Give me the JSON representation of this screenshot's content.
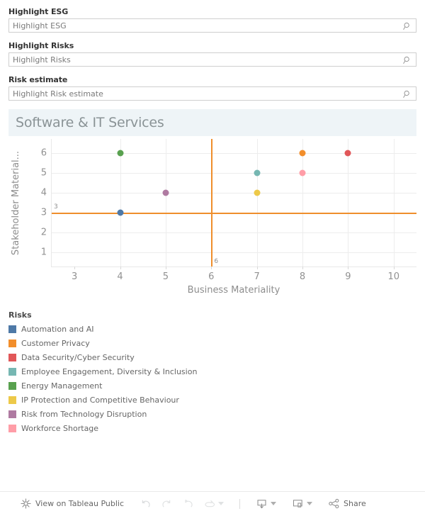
{
  "filters": [
    {
      "label": "Highlight ESG",
      "placeholder": "Highlight ESG",
      "value": "",
      "icon": "search-icon"
    },
    {
      "label": "Highlight Risks",
      "placeholder": "Highlight Risks",
      "value": "",
      "icon": "search-icon"
    },
    {
      "label": "Risk estimate",
      "placeholder": "Highlight Risk estimate",
      "value": "",
      "icon": "search-icon"
    }
  ],
  "viz": {
    "title": "Software & IT Services",
    "title_bg": "#eef4f7"
  },
  "legend": {
    "title": "Risks",
    "items": [
      {
        "label": "Automation and AI",
        "color": "#4e79a7"
      },
      {
        "label": "Customer Privacy",
        "color": "#f28e2b"
      },
      {
        "label": "Data Security/Cyber Security",
        "color": "#e15759"
      },
      {
        "label": "Employee Engagement, Diversity & Inclusion",
        "color": "#76b7b2"
      },
      {
        "label": "Energy Management",
        "color": "#59a14f"
      },
      {
        "label": "IP Protection and Competitive Behaviour",
        "color": "#edc949"
      },
      {
        "label": "Risk from Technology Disruption",
        "color": "#af7aa1"
      },
      {
        "label": "Workforce Shortage",
        "color": "#ff9da7"
      }
    ]
  },
  "toolbar": {
    "view_label": "View on Tableau Public",
    "share_label": "Share",
    "icons": {
      "tableau": "tableau-logo-icon",
      "undo": "undo-icon",
      "redo": "redo-icon",
      "revert": "revert-icon",
      "refresh": "refresh-icon",
      "refresh_caret": "chevron-down-icon",
      "download": "download-icon",
      "download_caret": "chevron-down-icon",
      "device": "device-preview-icon",
      "device_caret": "chevron-down-icon",
      "share": "share-icon"
    }
  },
  "chart_data": {
    "type": "scatter",
    "title": "Software & IT Services",
    "xlabel": "Business Materiality",
    "ylabel": "Stakeholder Material...",
    "ylabel_full": "Stakeholder Materiality",
    "xlim": [
      2.5,
      10.5
    ],
    "ylim": [
      0.3,
      6.7
    ],
    "xticks": [
      3,
      4,
      5,
      6,
      7,
      8,
      9,
      10
    ],
    "yticks": [
      1,
      2,
      3,
      4,
      5,
      6
    ],
    "grid": true,
    "legend_position": "below",
    "reference_lines": [
      {
        "axis": "x",
        "value": 6,
        "label": "6",
        "color": "#ef8e2c"
      },
      {
        "axis": "y",
        "value": 3,
        "label": "3",
        "color": "#ef8e2c"
      }
    ],
    "points": [
      {
        "label": "Automation and AI",
        "x": 4,
        "y": 3,
        "color": "#4e79a7"
      },
      {
        "label": "Customer Privacy",
        "x": 8,
        "y": 6,
        "color": "#f28e2b"
      },
      {
        "label": "Data Security/Cyber Security",
        "x": 9,
        "y": 6,
        "color": "#e15759"
      },
      {
        "label": "Employee Engagement, Diversity & Inclusion",
        "x": 7,
        "y": 5,
        "color": "#76b7b2"
      },
      {
        "label": "Energy Management",
        "x": 4,
        "y": 6,
        "color": "#59a14f"
      },
      {
        "label": "IP Protection and Competitive Behaviour",
        "x": 7,
        "y": 4,
        "color": "#edc949"
      },
      {
        "label": "Risk from Technology Disruption",
        "x": 5,
        "y": 4,
        "color": "#af7aa1"
      },
      {
        "label": "Workforce Shortage",
        "x": 8,
        "y": 5,
        "color": "#ff9da7"
      }
    ]
  }
}
